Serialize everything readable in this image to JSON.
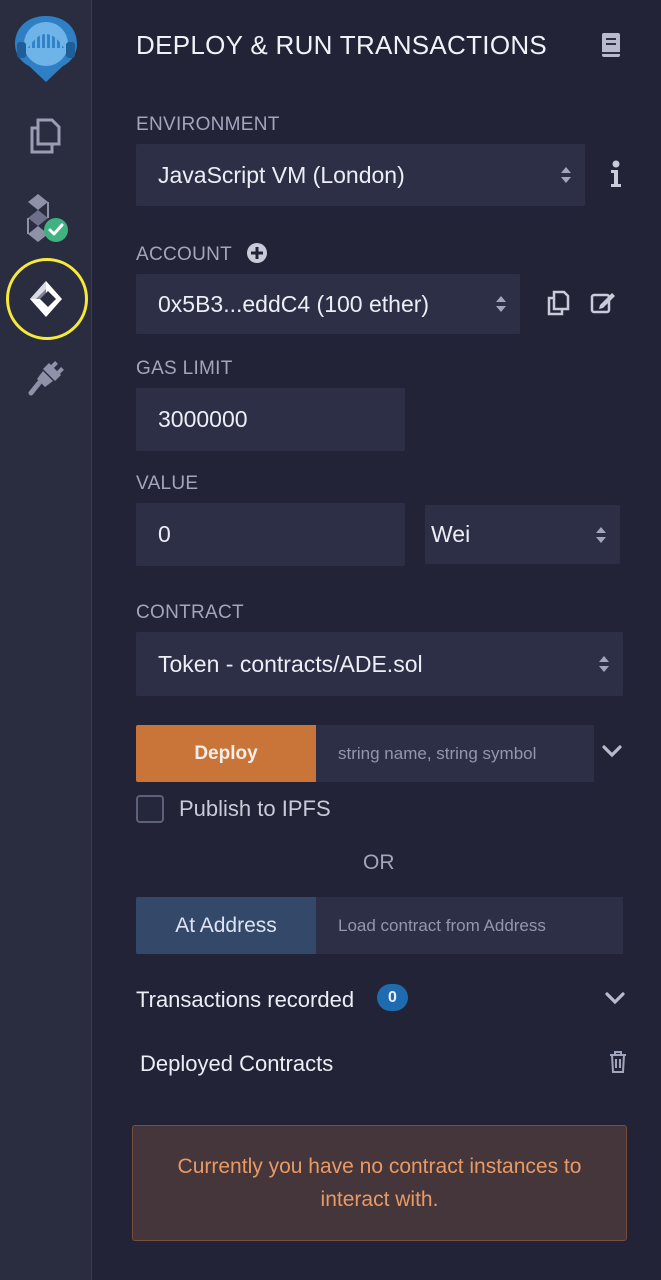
{
  "sidebar": {
    "icons": [
      "remix-logo-icon",
      "file-explorer-icon",
      "solidity-compiler-icon",
      "deploy-run-icon",
      "plugin-manager-icon"
    ],
    "compiler_status": "success",
    "active_ring_color": "#f5ea3b"
  },
  "header": {
    "title": "DEPLOY & RUN TRANSACTIONS",
    "doc_icon": "book-icon"
  },
  "environment": {
    "label": "ENVIRONMENT",
    "value": "JavaScript VM (London)"
  },
  "account": {
    "label": "ACCOUNT",
    "value": "0x5B3...eddC4 (100 ether)"
  },
  "gas_limit": {
    "label": "GAS LIMIT",
    "value": "3000000"
  },
  "value": {
    "label": "VALUE",
    "amount": "0",
    "unit": "Wei"
  },
  "contract": {
    "label": "CONTRACT",
    "value": "Token - contracts/ADE.sol"
  },
  "deploy": {
    "button_label": "Deploy",
    "args_placeholder": "string name, string symbol",
    "publish_label": "Publish to IPFS",
    "publish_checked": false
  },
  "or_label": "OR",
  "at_address": {
    "button_label": "At Address",
    "placeholder": "Load contract from Address"
  },
  "transactions": {
    "label": "Transactions recorded",
    "count": "0"
  },
  "deployed": {
    "label": "Deployed Contracts",
    "empty_message": "Currently you have no contract instances to interact with."
  },
  "colors": {
    "background": "#222336",
    "sidebar": "#2a2c3f",
    "field": "#2c2f45",
    "deploy_orange": "#c97539",
    "at_address_blue": "#34496a",
    "badge_blue": "#1e6bb0",
    "notice_text": "#e99a64",
    "success_green": "#3fb27f"
  }
}
